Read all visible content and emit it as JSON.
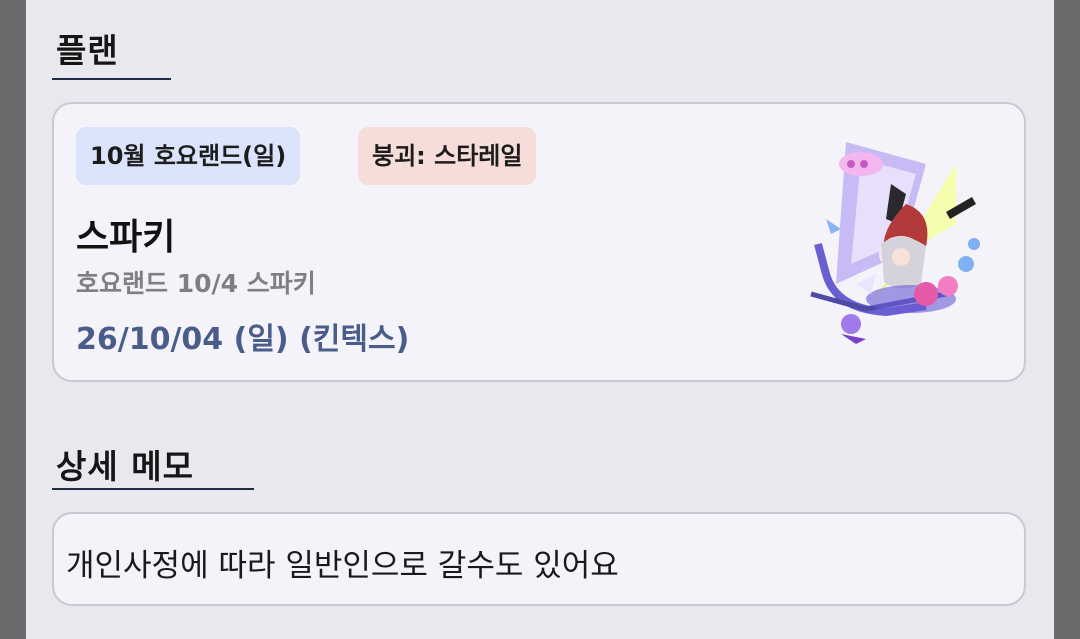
{
  "plan_section": {
    "title": "플랜",
    "badges": [
      "10월 호요랜드(일)",
      "붕괴: 스타레일"
    ],
    "name": "스파키",
    "subtitle": "호요랜드 10/4 스파키",
    "date": "26/10/04 (일) (킨텍스)",
    "image": "character-artwork"
  },
  "memo_section": {
    "title": "상세 메모",
    "text": "개인사정에 따라 일반인으로 갈수도 있어요"
  },
  "colors": {
    "badge_event": "#dbe4fb",
    "badge_game": "#f7ddd9",
    "accent": "#4a5d8a"
  }
}
